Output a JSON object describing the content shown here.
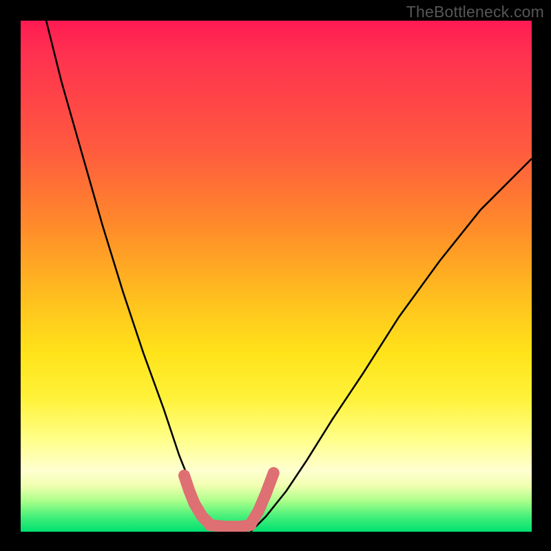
{
  "watermark": "TheBottleneck.com",
  "colors": {
    "background": "#000000",
    "curve": "#000000",
    "marker": "#de6f73",
    "gradient_top": "#ff1a53",
    "gradient_bottom": "#00e070"
  },
  "chart_data": {
    "type": "line",
    "title": "",
    "xlabel": "",
    "ylabel": "",
    "xlim": [
      0,
      100
    ],
    "ylim": [
      0,
      100
    ],
    "notes": "V-shaped bottleneck curve over rainbow gradient. Y estimated as percentage of plot height from bottom; X as percentage from left. Curve minimum (~0) lies roughly at x 35–45. Pink marker segments sit near the trough on both sides.",
    "series": [
      {
        "name": "curve-left",
        "x": [
          5,
          8,
          12,
          16,
          20,
          24,
          28,
          31,
          33,
          35,
          37,
          40
        ],
        "y": [
          100,
          88,
          74,
          60,
          47,
          35,
          24,
          15,
          10,
          5,
          2,
          0
        ]
      },
      {
        "name": "curve-right",
        "x": [
          45,
          48,
          52,
          56,
          61,
          67,
          74,
          82,
          90,
          100
        ],
        "y": [
          0,
          3,
          8,
          14,
          22,
          31,
          42,
          53,
          63,
          73
        ]
      },
      {
        "name": "marker-left",
        "x": [
          32.0,
          33.0,
          34.0,
          35.5,
          37.0
        ],
        "y": [
          11.0,
          8.0,
          5.5,
          3.0,
          1.5
        ]
      },
      {
        "name": "marker-bottom",
        "x": [
          37.0,
          40.0,
          43.0,
          45.0
        ],
        "y": [
          1.3,
          1.0,
          1.0,
          1.3
        ]
      },
      {
        "name": "marker-right",
        "x": [
          45.0,
          46.5,
          48.0,
          49.5
        ],
        "y": [
          1.5,
          4.0,
          7.5,
          11.5
        ]
      }
    ]
  }
}
